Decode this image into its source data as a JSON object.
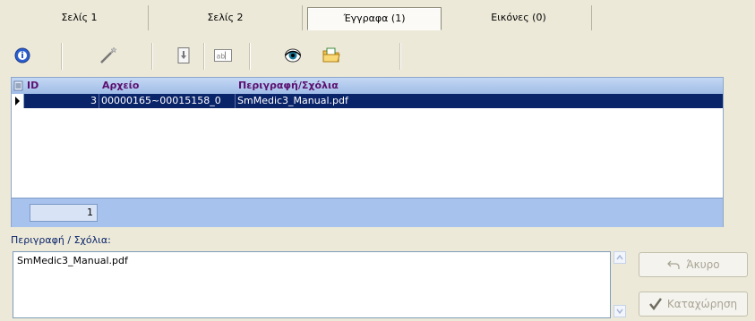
{
  "tabs": [
    {
      "label": "Σελίς 1",
      "active": false
    },
    {
      "label": "Σελίς 2",
      "active": false
    },
    {
      "label": "Έγγραφα (1)",
      "active": true
    },
    {
      "label": "Εικόνες (0)",
      "active": false
    }
  ],
  "toolbar": {
    "icons": [
      "info-icon",
      "magic-wand-icon",
      "import-icon",
      "rename-icon",
      "view-eye-icon",
      "folder-icon"
    ]
  },
  "grid": {
    "columns": [
      "ID",
      "Αρχείο",
      "Περιγραφή/Σχόλια"
    ],
    "rows": [
      {
        "id": "3",
        "file": "00000165~00015158_0",
        "description": "SmMedic3_Manual.pdf"
      }
    ],
    "footer_count": "1",
    "colors": {
      "header": "#a7c2ec",
      "selected_row": "#0a246a",
      "header_text": "#5c1070"
    }
  },
  "description": {
    "label": "Περιγραφή / Σχόλια:",
    "value": "SmMedic3_Manual.pdf"
  },
  "actions": {
    "cancel_label": "Άκυρο",
    "save_label": "Καταχώρηση"
  }
}
